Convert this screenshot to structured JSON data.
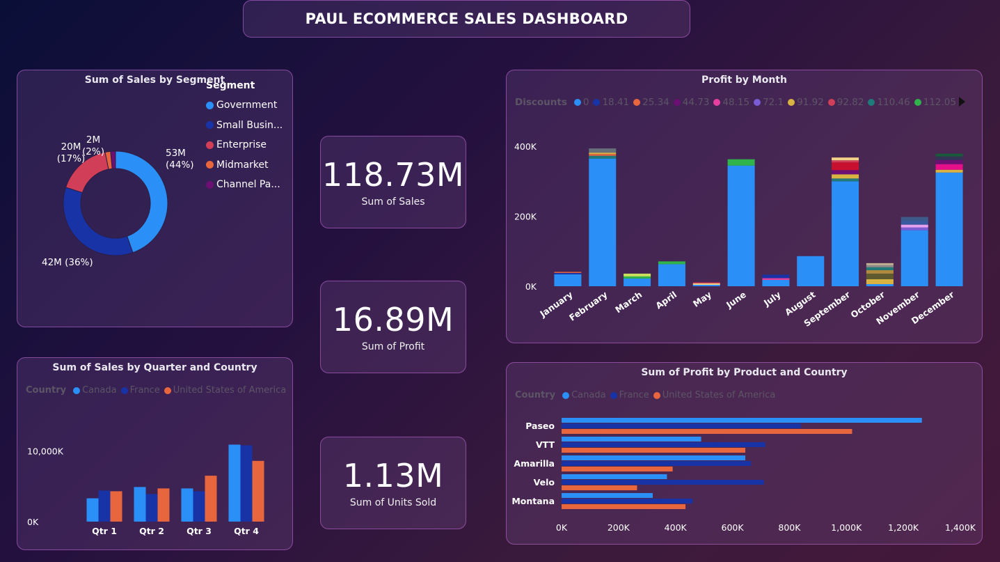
{
  "header": {
    "title": "PAUL ECOMMERCE SALES DASHBOARD"
  },
  "kpis": [
    {
      "value": "118.73M",
      "label": "Sum of Sales"
    },
    {
      "value": "16.89M",
      "label": "Sum of Profit"
    },
    {
      "value": "1.13M",
      "label": "Sum of Units Sold"
    }
  ],
  "segment_legend": {
    "title": "Segment",
    "items": [
      {
        "label": "Government",
        "color": "#2a8ff7"
      },
      {
        "label": "Small Busin...",
        "color": "#1733a6"
      },
      {
        "label": "Enterprise",
        "color": "#d13e57"
      },
      {
        "label": "Midmarket",
        "color": "#e8663d"
      },
      {
        "label": "Channel Pa...",
        "color": "#6b0f73"
      }
    ]
  },
  "discount_legend": {
    "title": "Discounts",
    "items": [
      {
        "label": "0",
        "color": "#2a8ff7"
      },
      {
        "label": "18.41",
        "color": "#1733a6"
      },
      {
        "label": "25.34",
        "color": "#e8663d"
      },
      {
        "label": "44.73",
        "color": "#6b0f73"
      },
      {
        "label": "48.15",
        "color": "#e63fa0"
      },
      {
        "label": "72.1",
        "color": "#7a5cd6"
      },
      {
        "label": "91.92",
        "color": "#d9b341"
      },
      {
        "label": "92.82",
        "color": "#d13e57"
      },
      {
        "label": "110.46",
        "color": "#1f7a7a"
      },
      {
        "label": "112.05",
        "color": "#2fb34a"
      }
    ]
  },
  "country_legend_q": {
    "title": "Country",
    "items": [
      {
        "label": "Canada",
        "color": "#2a8ff7"
      },
      {
        "label": "France",
        "color": "#1733a6"
      },
      {
        "label": "United States of America",
        "color": "#e8663d"
      }
    ]
  },
  "country_legend_p": {
    "title": "Country",
    "items": [
      {
        "label": "Canada",
        "color": "#2a8ff7"
      },
      {
        "label": "France",
        "color": "#1733a6"
      },
      {
        "label": "United States of America",
        "color": "#e8663d"
      }
    ]
  },
  "chart_data": [
    {
      "type": "pie",
      "title": "Sum of Sales by Segment",
      "categories": [
        "Government",
        "Small Business",
        "Enterprise",
        "Midmarket",
        "Channel Partners"
      ],
      "values": [
        53,
        42,
        20,
        2,
        1.8
      ],
      "data_labels": [
        "53M\n(44%)",
        "42M (36%)",
        "20M\n(17%)",
        "2M\n(2%)",
        ""
      ],
      "colors": [
        "#2a8ff7",
        "#1733a6",
        "#d13e57",
        "#e8663d",
        "#6b0f73"
      ]
    },
    {
      "type": "bar",
      "title": "Profit by Month",
      "stacked": true,
      "categories": [
        "January",
        "February",
        "March",
        "April",
        "May",
        "June",
        "July",
        "August",
        "September",
        "October",
        "November",
        "December"
      ],
      "y_ticks": [
        "0K",
        "200K",
        "400K"
      ],
      "ylim": [
        0,
        440000
      ],
      "stacks": [
        [
          {
            "v": 34000,
            "c": "#2a8ff7"
          },
          {
            "v": 4000,
            "c": "#1733a6"
          },
          {
            "v": 3000,
            "c": "#e8663d"
          }
        ],
        [
          {
            "v": 365000,
            "c": "#2a8ff7"
          },
          {
            "v": 8000,
            "c": "#1f7a7a"
          },
          {
            "v": 5000,
            "c": "#e8663d"
          },
          {
            "v": 4000,
            "c": "#d9b341"
          },
          {
            "v": 12000,
            "c": "#666f7a"
          }
        ],
        [
          {
            "v": 22000,
            "c": "#2a8ff7"
          },
          {
            "v": 6000,
            "c": "#2fb34a"
          },
          {
            "v": 8000,
            "c": "#c8e05a"
          }
        ],
        [
          {
            "v": 63000,
            "c": "#2a8ff7"
          },
          {
            "v": 8000,
            "c": "#2fb34a"
          }
        ],
        [
          {
            "v": 4000,
            "c": "#2a8ff7"
          },
          {
            "v": 4000,
            "c": "#f3d28a"
          },
          {
            "v": 3000,
            "c": "#d13e57"
          }
        ],
        [
          {
            "v": 345000,
            "c": "#2a8ff7"
          },
          {
            "v": 18000,
            "c": "#2fb34a"
          }
        ],
        [
          {
            "v": 18000,
            "c": "#2a8ff7"
          },
          {
            "v": 5000,
            "c": "#e63fa0"
          },
          {
            "v": 10000,
            "c": "#1733a6"
          }
        ],
        [
          {
            "v": 86000,
            "c": "#2a8ff7"
          }
        ],
        [
          {
            "v": 300000,
            "c": "#2a8ff7"
          },
          {
            "v": 8000,
            "c": "#1f7a7a"
          },
          {
            "v": 12000,
            "c": "#d9b341"
          },
          {
            "v": 12000,
            "c": "#6b0f73"
          },
          {
            "v": 22000,
            "c": "#c8102e"
          },
          {
            "v": 6000,
            "c": "#d13e57"
          },
          {
            "v": 8000,
            "c": "#f3d28a"
          }
        ],
        [
          {
            "v": 6000,
            "c": "#2a8ff7"
          },
          {
            "v": 14000,
            "c": "#d9b341"
          },
          {
            "v": 16000,
            "c": "#5c5a2e"
          },
          {
            "v": 10000,
            "c": "#b08a3c"
          },
          {
            "v": 8000,
            "c": "#1f7a7a"
          },
          {
            "v": 6000,
            "c": "#8a8a8a"
          },
          {
            "v": 6000,
            "c": "#c0b090"
          }
        ],
        [
          {
            "v": 160000,
            "c": "#2a8ff7"
          },
          {
            "v": 8000,
            "c": "#7a5cd6"
          },
          {
            "v": 8000,
            "c": "#e8a0f0"
          },
          {
            "v": 12000,
            "c": "#3a5aa0"
          },
          {
            "v": 10000,
            "c": "#3d5a8a"
          }
        ],
        [
          {
            "v": 325000,
            "c": "#2a8ff7"
          },
          {
            "v": 8000,
            "c": "#d9b341"
          },
          {
            "v": 16000,
            "c": "#e60f8a"
          },
          {
            "v": 12000,
            "c": "#6b0f73"
          },
          {
            "v": 10000,
            "c": "#333355"
          },
          {
            "v": 8000,
            "c": "#1a5a3a"
          }
        ]
      ]
    },
    {
      "type": "bar",
      "title": "Sum of Sales by Quarter and Country",
      "categories": [
        "Qtr 1",
        "Qtr 2",
        "Qtr 3",
        "Qtr 4"
      ],
      "y_ticks": [
        "0K",
        "10,000K"
      ],
      "ylim": [
        0,
        14200000
      ],
      "series": [
        {
          "name": "Canada",
          "color": "#2a8ff7",
          "values": [
            3300000,
            4900000,
            4700000,
            10900000
          ]
        },
        {
          "name": "France",
          "color": "#1733a6",
          "values": [
            4400000,
            3900000,
            4300000,
            10800000
          ]
        },
        {
          "name": "United States of America",
          "color": "#e8663d",
          "values": [
            4300000,
            4700000,
            6500000,
            8600000
          ]
        }
      ]
    },
    {
      "type": "bar",
      "orientation": "horizontal",
      "title": "Sum of Profit by Product and Country",
      "categories": [
        "Paseo",
        "VTT",
        "Amarilla",
        "Velo",
        "Montana"
      ],
      "x_ticks": [
        "0K",
        "200K",
        "400K",
        "600K",
        "800K",
        "1,000K",
        "1,200K",
        "1,400K"
      ],
      "xlim": [
        0,
        1400000
      ],
      "series": [
        {
          "name": "Canada",
          "color": "#2a8ff7",
          "values": [
            1265000,
            490000,
            645000,
            370000,
            320000
          ]
        },
        {
          "name": "France",
          "color": "#1733a6",
          "values": [
            840000,
            715000,
            665000,
            710000,
            460000
          ]
        },
        {
          "name": "United States of America",
          "color": "#e8663d",
          "values": [
            1020000,
            645000,
            390000,
            265000,
            435000
          ]
        }
      ]
    }
  ]
}
